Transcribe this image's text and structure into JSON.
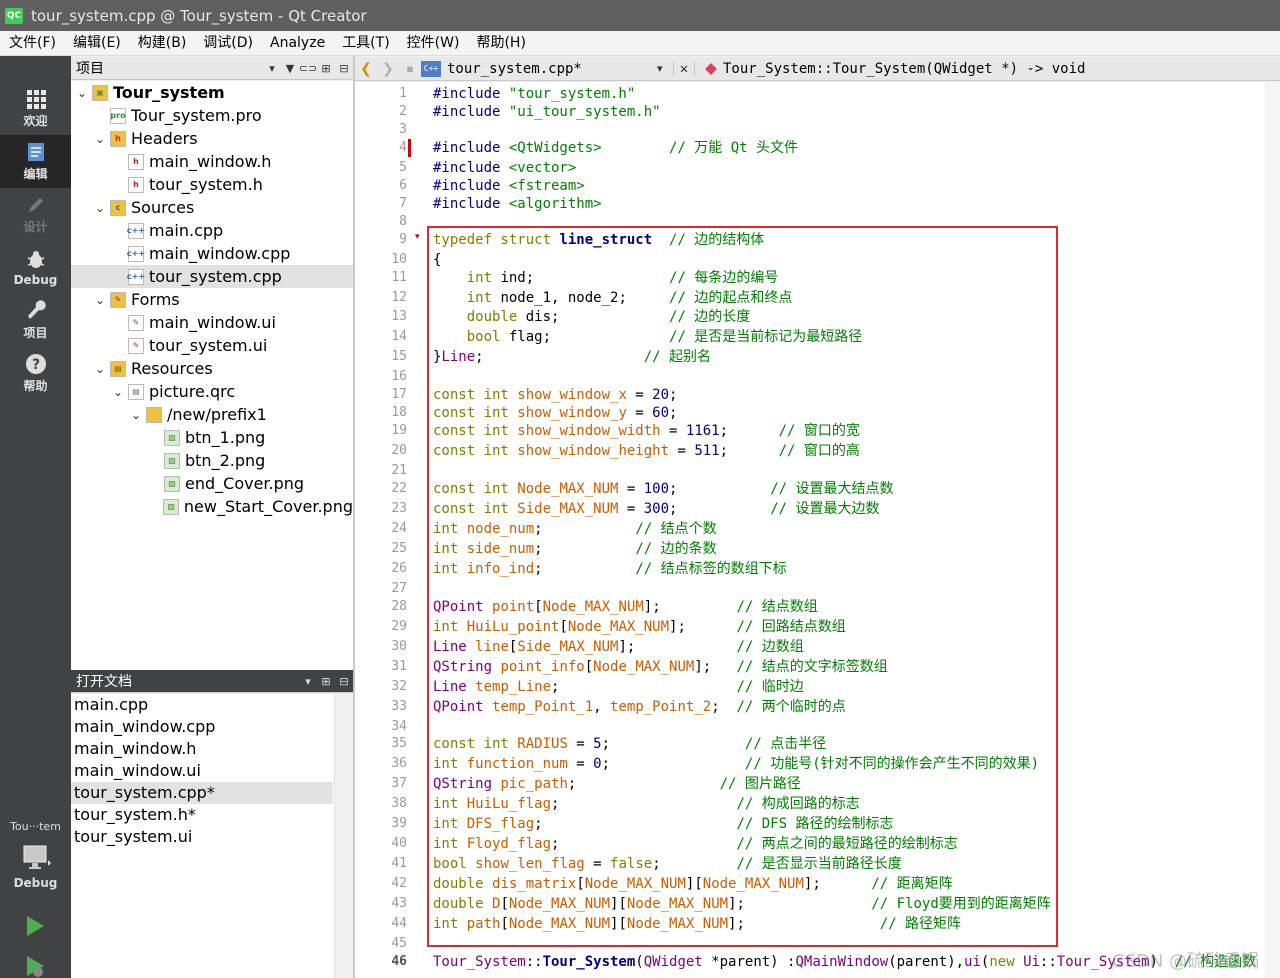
{
  "window": {
    "title": "tour_system.cpp @ Tour_system - Qt Creator",
    "app_icon": "QC"
  },
  "menu": [
    "文件(F)",
    "编辑(E)",
    "构建(B)",
    "调试(D)",
    "Analyze",
    "工具(T)",
    "控件(W)",
    "帮助(H)"
  ],
  "modes": [
    {
      "label": "欢迎",
      "icon": "grid-icon"
    },
    {
      "label": "编辑",
      "icon": "document-icon"
    },
    {
      "label": "设计",
      "icon": "pencil-icon"
    },
    {
      "label": "Debug",
      "icon": "bug-icon"
    },
    {
      "label": "项目",
      "icon": "wrench-icon"
    },
    {
      "label": "帮助",
      "icon": "help-icon"
    }
  ],
  "target": {
    "name": "Tou···tem",
    "mode": "Debug"
  },
  "project_pane": {
    "title": "项目",
    "tree": [
      {
        "label": "Tour_system",
        "level": 0,
        "arrow": "down",
        "icon": "project",
        "bold": true
      },
      {
        "label": "Tour_system.pro",
        "level": 1,
        "arrow": "",
        "icon": "pro"
      },
      {
        "label": "Headers",
        "level": 1,
        "arrow": "down",
        "icon": "folder-h"
      },
      {
        "label": "main_window.h",
        "level": 2,
        "arrow": "",
        "icon": "h"
      },
      {
        "label": "tour_system.h",
        "level": 2,
        "arrow": "",
        "icon": "h"
      },
      {
        "label": "Sources",
        "level": 1,
        "arrow": "down",
        "icon": "folder-c"
      },
      {
        "label": "main.cpp",
        "level": 2,
        "arrow": "",
        "icon": "cpp"
      },
      {
        "label": "main_window.cpp",
        "level": 2,
        "arrow": "",
        "icon": "cpp"
      },
      {
        "label": "tour_system.cpp",
        "level": 2,
        "arrow": "",
        "icon": "cpp",
        "selected": true
      },
      {
        "label": "Forms",
        "level": 1,
        "arrow": "down",
        "icon": "folder-ui"
      },
      {
        "label": "main_window.ui",
        "level": 2,
        "arrow": "",
        "icon": "ui"
      },
      {
        "label": "tour_system.ui",
        "level": 2,
        "arrow": "",
        "icon": "ui"
      },
      {
        "label": "Resources",
        "level": 1,
        "arrow": "down",
        "icon": "folder-res"
      },
      {
        "label": "picture.qrc",
        "level": 2,
        "arrow": "down",
        "icon": "qrc"
      },
      {
        "label": "/new/prefix1",
        "level": 3,
        "arrow": "down",
        "icon": "folder"
      },
      {
        "label": "btn_1.png",
        "level": 4,
        "arrow": "",
        "icon": "png"
      },
      {
        "label": "btn_2.png",
        "level": 4,
        "arrow": "",
        "icon": "png"
      },
      {
        "label": "end_Cover.png",
        "level": 4,
        "arrow": "",
        "icon": "png"
      },
      {
        "label": "new_Start_Cover.png",
        "level": 4,
        "arrow": "",
        "icon": "png"
      }
    ]
  },
  "open_docs": {
    "title": "打开文档",
    "items": [
      {
        "label": "main.cpp"
      },
      {
        "label": "main_window.cpp"
      },
      {
        "label": "main_window.h"
      },
      {
        "label": "main_window.ui"
      },
      {
        "label": "tour_system.cpp*",
        "selected": true
      },
      {
        "label": "tour_system.h*"
      },
      {
        "label": "tour_system.ui"
      }
    ]
  },
  "editor": {
    "file": "tour_system.cpp*",
    "symbol": "Tour_System::Tour_System(QWidget *) -> void",
    "current_line": 46,
    "lines": [
      [
        [
          "pp",
          "#include "
        ],
        [
          "str",
          "\"tour_system.h\""
        ]
      ],
      [
        [
          "pp",
          "#include "
        ],
        [
          "str",
          "\"ui_tour_system.h\""
        ]
      ],
      [],
      [
        [
          "pp",
          "#include "
        ],
        [
          "hdr",
          "<QtWidgets>"
        ],
        [
          "t",
          "        "
        ],
        [
          "cm",
          "// 万能 Qt 头文件"
        ]
      ],
      [
        [
          "pp",
          "#include "
        ],
        [
          "hdr",
          "<vector>"
        ]
      ],
      [
        [
          "pp",
          "#include "
        ],
        [
          "hdr",
          "<fstream>"
        ]
      ],
      [
        [
          "pp",
          "#include "
        ],
        [
          "hdr",
          "<algorithm>"
        ]
      ],
      [],
      [
        [
          "kw",
          "typedef struct "
        ],
        [
          "kb",
          "line_struct"
        ],
        [
          "t",
          "  "
        ],
        [
          "cm",
          "// 边的结构体"
        ]
      ],
      [
        [
          "t",
          "{"
        ]
      ],
      [
        [
          "t",
          "    "
        ],
        [
          "kw",
          "int"
        ],
        [
          "t",
          " ind;                "
        ],
        [
          "cm",
          "// 每条边的编号"
        ]
      ],
      [
        [
          "t",
          "    "
        ],
        [
          "kw",
          "int"
        ],
        [
          "t",
          " node_1, node_2;     "
        ],
        [
          "cm",
          "// 边的起点和终点"
        ]
      ],
      [
        [
          "t",
          "    "
        ],
        [
          "kw",
          "double"
        ],
        [
          "t",
          " dis;             "
        ],
        [
          "cm",
          "// 边的长度"
        ]
      ],
      [
        [
          "t",
          "    "
        ],
        [
          "kw",
          "bool"
        ],
        [
          "t",
          " flag;              "
        ],
        [
          "cm",
          "// 是否是当前标记为最短路径"
        ]
      ],
      [
        [
          "t",
          "}"
        ],
        [
          "ty",
          "Line"
        ],
        [
          "t",
          ";                   "
        ],
        [
          "cm",
          "// 起别名"
        ]
      ],
      [],
      [
        [
          "kw",
          "const int "
        ],
        [
          "gl",
          "show_window_x"
        ],
        [
          "t",
          " = "
        ],
        [
          "num",
          "20"
        ],
        [
          "t",
          ";"
        ]
      ],
      [
        [
          "kw",
          "const int "
        ],
        [
          "gl",
          "show_window_y"
        ],
        [
          "t",
          " = "
        ],
        [
          "num",
          "60"
        ],
        [
          "t",
          ";"
        ]
      ],
      [
        [
          "kw",
          "const int "
        ],
        [
          "gl",
          "show_window_width"
        ],
        [
          "t",
          " = "
        ],
        [
          "num",
          "1161"
        ],
        [
          "t",
          ";      "
        ],
        [
          "cm",
          "// 窗口的宽"
        ]
      ],
      [
        [
          "kw",
          "const int "
        ],
        [
          "gl",
          "show_window_height"
        ],
        [
          "t",
          " = "
        ],
        [
          "num",
          "511"
        ],
        [
          "t",
          ";      "
        ],
        [
          "cm",
          "// 窗口的高"
        ]
      ],
      [],
      [
        [
          "kw",
          "const int "
        ],
        [
          "gl",
          "Node_MAX_NUM"
        ],
        [
          "t",
          " = "
        ],
        [
          "num",
          "100"
        ],
        [
          "t",
          ";           "
        ],
        [
          "cm",
          "// 设置最大结点数"
        ]
      ],
      [
        [
          "kw",
          "const int "
        ],
        [
          "gl",
          "Side_MAX_NUM"
        ],
        [
          "t",
          " = "
        ],
        [
          "num",
          "300"
        ],
        [
          "t",
          ";           "
        ],
        [
          "cm",
          "// 设置最大边数"
        ]
      ],
      [
        [
          "kw",
          "int "
        ],
        [
          "gl",
          "node_num"
        ],
        [
          "t",
          ";           "
        ],
        [
          "cm",
          "// 结点个数"
        ]
      ],
      [
        [
          "kw",
          "int "
        ],
        [
          "gl",
          "side_num"
        ],
        [
          "t",
          ";           "
        ],
        [
          "cm",
          "// 边的条数"
        ]
      ],
      [
        [
          "kw",
          "int "
        ],
        [
          "gl",
          "info_ind"
        ],
        [
          "t",
          ";           "
        ],
        [
          "cm",
          "// 结点标签的数组下标"
        ]
      ],
      [],
      [
        [
          "ty",
          "QPoint "
        ],
        [
          "gl",
          "point"
        ],
        [
          "t",
          "["
        ],
        [
          "gl",
          "Node_MAX_NUM"
        ],
        [
          "t",
          "];         "
        ],
        [
          "cm",
          "// 结点数组"
        ]
      ],
      [
        [
          "kw",
          "int "
        ],
        [
          "gl",
          "HuiLu_point"
        ],
        [
          "t",
          "["
        ],
        [
          "gl",
          "Node_MAX_NUM"
        ],
        [
          "t",
          "];      "
        ],
        [
          "cm",
          "// 回路结点数组"
        ]
      ],
      [
        [
          "ty",
          "Line "
        ],
        [
          "gl",
          "line"
        ],
        [
          "t",
          "["
        ],
        [
          "gl",
          "Side_MAX_NUM"
        ],
        [
          "t",
          "];            "
        ],
        [
          "cm",
          "// 边数组"
        ]
      ],
      [
        [
          "ty",
          "QString "
        ],
        [
          "gl",
          "point_info"
        ],
        [
          "t",
          "["
        ],
        [
          "gl",
          "Node_MAX_NUM"
        ],
        [
          "t",
          "];   "
        ],
        [
          "cm",
          "// 结点的文字标签数组"
        ]
      ],
      [
        [
          "ty",
          "Line "
        ],
        [
          "gl",
          "temp_Line"
        ],
        [
          "t",
          ";                     "
        ],
        [
          "cm",
          "// 临时边"
        ]
      ],
      [
        [
          "ty",
          "QPoint "
        ],
        [
          "gl",
          "temp_Point_1"
        ],
        [
          "t",
          ", "
        ],
        [
          "gl",
          "temp_Point_2"
        ],
        [
          "t",
          ";  "
        ],
        [
          "cm",
          "// 两个临时的点"
        ]
      ],
      [],
      [
        [
          "kw",
          "const int "
        ],
        [
          "gl",
          "RADIUS"
        ],
        [
          "t",
          " = "
        ],
        [
          "num",
          "5"
        ],
        [
          "t",
          ";                "
        ],
        [
          "cm",
          "// 点击半径"
        ]
      ],
      [
        [
          "kw",
          "int "
        ],
        [
          "gl",
          "function_num"
        ],
        [
          "t",
          " = "
        ],
        [
          "num",
          "0"
        ],
        [
          "t",
          ";                "
        ],
        [
          "cm",
          "// 功能号(针对不同的操作会产生不同的效果)"
        ]
      ],
      [
        [
          "ty",
          "QString "
        ],
        [
          "gl",
          "pic_path"
        ],
        [
          "t",
          ";                 "
        ],
        [
          "cm",
          "// 图片路径"
        ]
      ],
      [
        [
          "kw",
          "int "
        ],
        [
          "gl",
          "HuiLu_flag"
        ],
        [
          "t",
          ";                     "
        ],
        [
          "cm",
          "// 构成回路的标志"
        ]
      ],
      [
        [
          "kw",
          "int "
        ],
        [
          "gl",
          "DFS_flag"
        ],
        [
          "t",
          ";                       "
        ],
        [
          "cm",
          "// DFS 路径的绘制标志"
        ]
      ],
      [
        [
          "kw",
          "int "
        ],
        [
          "gl",
          "Floyd_flag"
        ],
        [
          "t",
          ";                     "
        ],
        [
          "cm",
          "// 两点之间的最短路径的绘制标志"
        ]
      ],
      [
        [
          "kw",
          "bool "
        ],
        [
          "gl",
          "show_len_flag"
        ],
        [
          "t",
          " = "
        ],
        [
          "kw",
          "false"
        ],
        [
          "t",
          ";         "
        ],
        [
          "cm",
          "// 是否显示当前路径长度"
        ]
      ],
      [
        [
          "kw",
          "double "
        ],
        [
          "gl",
          "dis_matrix"
        ],
        [
          "t",
          "["
        ],
        [
          "gl",
          "Node_MAX_NUM"
        ],
        [
          "t",
          "]["
        ],
        [
          "gl",
          "Node_MAX_NUM"
        ],
        [
          "t",
          "];      "
        ],
        [
          "cm",
          "// 距离矩阵"
        ]
      ],
      [
        [
          "kw",
          "double "
        ],
        [
          "gl",
          "D"
        ],
        [
          "t",
          "["
        ],
        [
          "gl",
          "Node_MAX_NUM"
        ],
        [
          "t",
          "]["
        ],
        [
          "gl",
          "Node_MAX_NUM"
        ],
        [
          "t",
          "];               "
        ],
        [
          "cm",
          "// Floyd要用到的距离矩阵"
        ]
      ],
      [
        [
          "kw",
          "int "
        ],
        [
          "gl",
          "path"
        ],
        [
          "t",
          "["
        ],
        [
          "gl",
          "Node_MAX_NUM"
        ],
        [
          "t",
          "]["
        ],
        [
          "gl",
          "Node_MAX_NUM"
        ],
        [
          "t",
          "];                "
        ],
        [
          "cm",
          "// 路径矩阵"
        ]
      ],
      [],
      [
        [
          "ty",
          "Tour_System"
        ],
        [
          "t",
          "::"
        ],
        [
          "kb",
          "Tour_System"
        ],
        [
          "t",
          "("
        ],
        [
          "ty",
          "QWidget"
        ],
        [
          "t",
          " *parent) :"
        ],
        [
          "ty",
          "QMainWindow"
        ],
        [
          "t",
          "(parent),"
        ],
        [
          "ty",
          "ui"
        ],
        [
          "t",
          "("
        ],
        [
          "kw",
          "new "
        ],
        [
          "ty",
          "Ui"
        ],
        [
          "t",
          "::"
        ],
        [
          "ty",
          "Tour_System"
        ],
        [
          "t",
          ")  "
        ],
        [
          "cm",
          "// 构造函数"
        ]
      ]
    ]
  },
  "watermark": "CSDN @硫酸香锅"
}
